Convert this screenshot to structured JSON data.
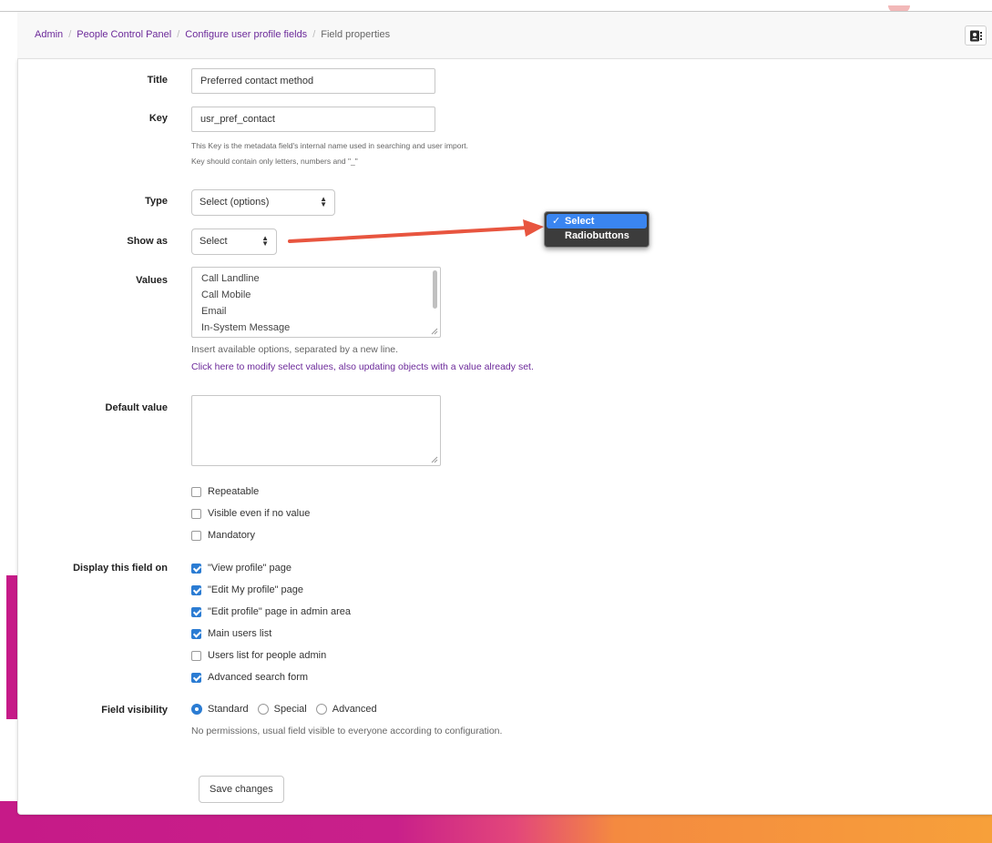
{
  "breadcrumb": {
    "items": [
      "Admin",
      "People Control Panel",
      "Configure user profile fields"
    ],
    "current": "Field properties",
    "separator": "/"
  },
  "form": {
    "title": {
      "label": "Title",
      "value": "Preferred contact method"
    },
    "key": {
      "label": "Key",
      "value": "usr_pref_contact",
      "help_line1": "This Key is the metadata field's internal name used in searching and user import.",
      "help_line2": "Key should contain only letters, numbers and \"_\""
    },
    "type": {
      "label": "Type",
      "value": "Select (options)"
    },
    "show_as": {
      "label": "Show as",
      "value": "Select"
    },
    "values": {
      "label": "Values",
      "lines": [
        "Call Landline",
        "Call Mobile",
        "Email",
        "In-System Message"
      ],
      "help": "Insert available options, separated by a new line.",
      "link": "Click here to modify select values, also updating objects with a value already set."
    },
    "default_value": {
      "label": "Default value",
      "value": ""
    },
    "options": [
      {
        "label": "Repeatable",
        "checked": false
      },
      {
        "label": "Visible even if no value",
        "checked": false
      },
      {
        "label": "Mandatory",
        "checked": false
      }
    ],
    "display_on": {
      "label": "Display this field on",
      "items": [
        {
          "label": "\"View profile\" page",
          "checked": true
        },
        {
          "label": "\"Edit My profile\" page",
          "checked": true
        },
        {
          "label": "\"Edit profile\" page in admin area",
          "checked": true
        },
        {
          "label": "Main users list",
          "checked": true
        },
        {
          "label": "Users list for people admin",
          "checked": false
        },
        {
          "label": "Advanced search form",
          "checked": true
        }
      ]
    },
    "visibility": {
      "label": "Field visibility",
      "options": [
        {
          "label": "Standard",
          "selected": true
        },
        {
          "label": "Special",
          "selected": false
        },
        {
          "label": "Advanced",
          "selected": false
        }
      ],
      "help": "No permissions, usual field visible to everyone according to configuration."
    },
    "save_label": "Save changes"
  },
  "popup": {
    "options": [
      {
        "label": "Select",
        "selected": true
      },
      {
        "label": "Radiobuttons",
        "selected": false
      }
    ],
    "checkmark": "✓"
  },
  "colors": {
    "link": "#6c2a9a",
    "accent": "#2b7cd3",
    "annotation_arrow": "#e8553f",
    "popup_highlight": "#3a85f0"
  },
  "icons": {
    "contact": "address-book-icon",
    "select_arrows": "⇕"
  }
}
